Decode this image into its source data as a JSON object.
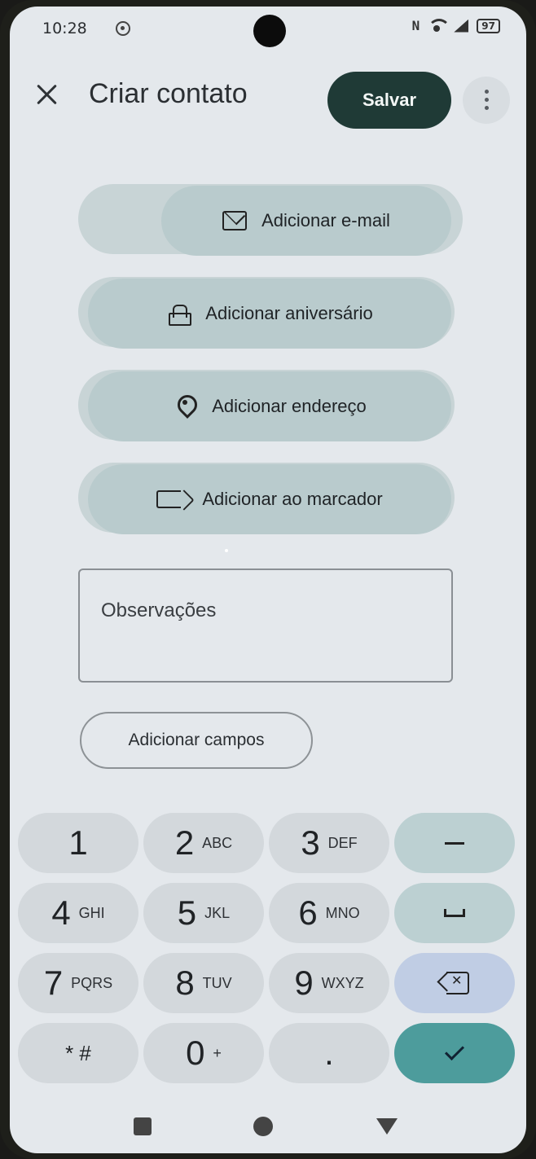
{
  "status_bar": {
    "time": "10:28",
    "nfc": "N",
    "battery": "97"
  },
  "header": {
    "title": "Criar contato",
    "save_label": "Salvar"
  },
  "actions": [
    {
      "label": "Adicionar e-mail",
      "icon": "mail-icon"
    },
    {
      "label": "Adicionar aniversário",
      "icon": "cake-icon"
    },
    {
      "label": "Adicionar endereço",
      "icon": "location-pin-icon"
    },
    {
      "label": "Adicionar ao marcador",
      "icon": "label-icon"
    }
  ],
  "notes": {
    "placeholder": "Observações"
  },
  "add_fields_label": "Adicionar campos",
  "keypad": {
    "rows": [
      [
        {
          "num": "1",
          "letters": ""
        },
        {
          "num": "2",
          "letters": "ABC"
        },
        {
          "num": "3",
          "letters": "DEF"
        }
      ],
      [
        {
          "num": "4",
          "letters": "GHI"
        },
        {
          "num": "5",
          "letters": "JKL"
        },
        {
          "num": "6",
          "letters": "MNO"
        }
      ],
      [
        {
          "num": "7",
          "letters": "PQRS"
        },
        {
          "num": "8",
          "letters": "TUV"
        },
        {
          "num": "9",
          "letters": "WXYZ"
        }
      ],
      [
        {
          "num": "* #",
          "letters": ""
        },
        {
          "num": "0",
          "letters": "+"
        },
        {
          "num": ".",
          "letters": ""
        }
      ]
    ],
    "function_keys": [
      "dash-icon",
      "space-icon",
      "backspace-icon",
      "check-icon"
    ]
  },
  "colors": {
    "save_button": "#1f3a36",
    "pill": "#b9cbcd",
    "done_key": "#4d9c9c",
    "backspace_key": "#c0cde4"
  }
}
